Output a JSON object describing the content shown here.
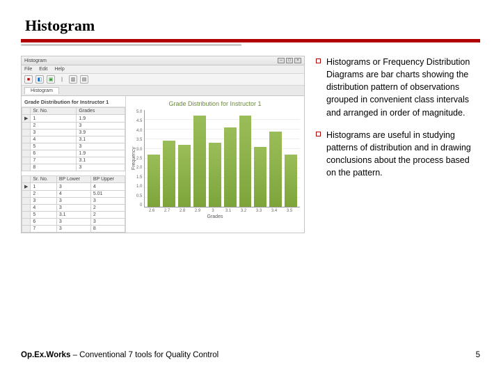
{
  "title": "Histogram",
  "body_text": {
    "p1": "Histograms or Frequency Distribution Diagrams are bar charts showing the distribution pattern of observations grouped in convenient class intervals and arranged in order of magnitude.",
    "p2": "Histograms are useful in studying patterns of distribution and in drawing conclusions about the process based on the pattern."
  },
  "footer": {
    "left_bold": "Op.Ex.Works",
    "left_rest": " –  Conventional 7 tools for Quality Control",
    "page_number": "5"
  },
  "app_window": {
    "title": "Histogram",
    "menus": [
      "File",
      "Edit",
      "Help"
    ],
    "tab": "Histogram",
    "sheet1_title": "Grade Distribution for Instructor 1",
    "sheet1_headers": [
      "Sr. No.",
      "Grades"
    ],
    "sheet1_rows": [
      [
        1,
        1.9
      ],
      [
        2,
        3.0
      ],
      [
        3,
        3.9
      ],
      [
        4,
        3.1
      ],
      [
        5,
        3.0
      ],
      [
        6,
        1.9
      ],
      [
        7,
        3.1
      ],
      [
        8,
        3.0
      ]
    ],
    "sheet2_headers": [
      "Sr. No.",
      "BP Lower",
      "BP Upper"
    ],
    "sheet2_rows": [
      [
        1,
        3.0,
        4.0
      ],
      [
        2,
        4.0,
        5.01
      ],
      [
        3,
        3.0,
        3.0
      ],
      [
        4,
        3.0,
        2.0
      ],
      [
        5,
        3.1,
        2.0
      ],
      [
        6,
        3.0,
        3.0
      ],
      [
        7,
        3.0,
        8.0
      ]
    ]
  },
  "chart_data": {
    "type": "bar",
    "title": "Grade Distribution for Instructor 1",
    "xlabel": "Grades",
    "ylabel": "Frequency",
    "categories": [
      "2.6",
      "2.7",
      "2.8",
      "2.9",
      "3",
      "3.1",
      "3.2",
      "3.3",
      "3.4",
      "3.5"
    ],
    "values": [
      2.7,
      3.4,
      3.2,
      4.7,
      3.3,
      4.1,
      4.7,
      3.1,
      3.9,
      2.7
    ],
    "ylim": [
      0,
      5
    ],
    "yticks": [
      "5.0",
      "4.5",
      "4.0",
      "3.5",
      "3.0",
      "2.5",
      "2.0",
      "1.5",
      "1.0",
      "0.5",
      "0"
    ]
  }
}
